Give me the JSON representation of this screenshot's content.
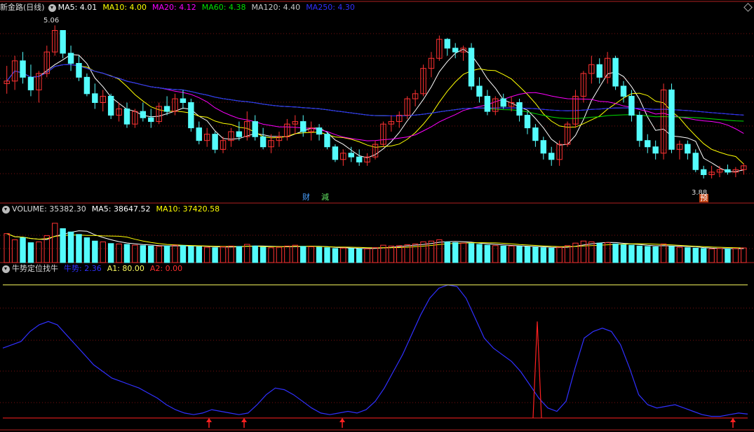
{
  "main_header": {
    "title": "新金路(日线)",
    "ma5": "MA5: 4.01",
    "ma10": "MA10: 4.00",
    "ma20": "MA20: 4.12",
    "ma60": "MA60: 4.38",
    "ma120": "MA120: 4.40",
    "ma250": "MA250: 4.30"
  },
  "volume_header": {
    "title": "VOLUME: 35382.30",
    "ma5": "MA5: 38647.52",
    "ma10": "MA10: 37420.58"
  },
  "indicator_header": {
    "title": "牛势定位找牛",
    "niushi": "牛势: 2.36",
    "a1": "A1: 80.00",
    "a2": "A2: 0.00"
  },
  "annotations": {
    "high_label": "5.06",
    "low_label": "3.88",
    "event_cai": "财",
    "event_jian": "減",
    "event_yu": "预"
  },
  "colors": {
    "up": "#ff3232",
    "down": "#54fcfc",
    "ma5": "#ffffff",
    "ma10": "#ffff00",
    "ma20": "#ff00ff",
    "ma60": "#00e000",
    "ma120": "#c8c8c8",
    "ma250": "#2020ff",
    "niushi_line": "#3030ff",
    "a1_line": "#ffff60",
    "a2_line": "#ff2020"
  },
  "chart_data": [
    {
      "type": "candlestick",
      "title": "新金路(日线)",
      "ylim": [
        3.7,
        5.15
      ],
      "high_marker": 5.06,
      "low_marker": 3.88,
      "ohlc": [
        [
          4.6,
          4.74,
          4.52,
          4.62
        ],
        [
          4.62,
          4.82,
          4.55,
          4.78
        ],
        [
          4.78,
          4.85,
          4.6,
          4.65
        ],
        [
          4.65,
          4.75,
          4.5,
          4.55
        ],
        [
          4.55,
          4.7,
          4.45,
          4.68
        ],
        [
          4.68,
          4.9,
          4.65,
          4.85
        ],
        [
          4.85,
          5.06,
          4.82,
          5.02
        ],
        [
          5.02,
          5.0,
          4.8,
          4.84
        ],
        [
          4.84,
          4.9,
          4.7,
          4.76
        ],
        [
          4.76,
          4.82,
          4.62,
          4.65
        ],
        [
          4.65,
          4.68,
          4.5,
          4.52
        ],
        [
          4.52,
          4.6,
          4.4,
          4.45
        ],
        [
          4.45,
          4.55,
          4.38,
          4.5
        ],
        [
          4.5,
          4.52,
          4.32,
          4.35
        ],
        [
          4.35,
          4.45,
          4.3,
          4.4
        ],
        [
          4.4,
          4.45,
          4.25,
          4.28
        ],
        [
          4.28,
          4.4,
          4.25,
          4.38
        ],
        [
          4.38,
          4.45,
          4.3,
          4.33
        ],
        [
          4.33,
          4.4,
          4.25,
          4.3
        ],
        [
          4.3,
          4.45,
          4.28,
          4.42
        ],
        [
          4.42,
          4.5,
          4.35,
          4.38
        ],
        [
          4.38,
          4.52,
          4.35,
          4.48
        ],
        [
          4.48,
          4.55,
          4.4,
          4.45
        ],
        [
          4.45,
          4.48,
          4.22,
          4.25
        ],
        [
          4.25,
          4.3,
          4.12,
          4.15
        ],
        [
          4.15,
          4.25,
          4.1,
          4.2
        ],
        [
          4.2,
          4.22,
          4.05,
          4.08
        ],
        [
          4.08,
          4.18,
          4.05,
          4.15
        ],
        [
          4.15,
          4.25,
          4.1,
          4.22
        ],
        [
          4.22,
          4.3,
          4.15,
          4.18
        ],
        [
          4.18,
          4.38,
          4.15,
          4.3
        ],
        [
          4.3,
          4.35,
          4.15,
          4.18
        ],
        [
          4.18,
          4.25,
          4.08,
          4.1
        ],
        [
          4.1,
          4.2,
          4.05,
          4.15
        ],
        [
          4.15,
          4.22,
          4.1,
          4.18
        ],
        [
          4.18,
          4.32,
          4.15,
          4.28
        ],
        [
          4.28,
          4.35,
          4.2,
          4.3
        ],
        [
          4.3,
          4.35,
          4.18,
          4.22
        ],
        [
          4.22,
          4.3,
          4.15,
          4.25
        ],
        [
          4.25,
          4.28,
          4.15,
          4.2
        ],
        [
          4.2,
          4.22,
          4.08,
          4.1
        ],
        [
          4.1,
          4.12,
          3.98,
          4.0
        ],
        [
          4.0,
          4.08,
          3.95,
          4.05
        ],
        [
          4.05,
          4.1,
          3.98,
          4.02
        ],
        [
          4.02,
          4.08,
          3.95,
          3.98
        ],
        [
          3.98,
          4.05,
          3.95,
          4.02
        ],
        [
          4.02,
          4.15,
          4.0,
          4.12
        ],
        [
          4.12,
          4.3,
          4.1,
          4.28
        ],
        [
          4.28,
          4.35,
          4.22,
          4.3
        ],
        [
          4.3,
          4.38,
          4.25,
          4.35
        ],
        [
          4.35,
          4.5,
          4.32,
          4.48
        ],
        [
          4.48,
          4.55,
          4.42,
          4.52
        ],
        [
          4.52,
          4.75,
          4.5,
          4.72
        ],
        [
          4.72,
          4.85,
          4.65,
          4.8
        ],
        [
          4.8,
          4.98,
          4.78,
          4.95
        ],
        [
          4.95,
          4.96,
          4.82,
          4.88
        ],
        [
          4.88,
          4.92,
          4.8,
          4.85
        ],
        [
          4.85,
          4.9,
          4.78,
          4.88
        ],
        [
          4.88,
          4.92,
          4.55,
          4.58
        ],
        [
          4.58,
          4.65,
          4.45,
          4.5
        ],
        [
          4.5,
          4.55,
          4.35,
          4.38
        ],
        [
          4.38,
          4.5,
          4.35,
          4.48
        ],
        [
          4.48,
          4.52,
          4.4,
          4.42
        ],
        [
          4.42,
          4.5,
          4.38,
          4.45
        ],
        [
          4.45,
          4.48,
          4.3,
          4.35
        ],
        [
          4.35,
          4.38,
          4.2,
          4.25
        ],
        [
          4.25,
          4.28,
          4.1,
          4.15
        ],
        [
          4.15,
          4.18,
          4.0,
          4.05
        ],
        [
          4.05,
          4.1,
          3.95,
          4.0
        ],
        [
          4.0,
          4.15,
          3.95,
          4.12
        ],
        [
          4.12,
          4.3,
          4.1,
          4.28
        ],
        [
          4.28,
          4.55,
          4.25,
          4.5
        ],
        [
          4.5,
          4.7,
          4.45,
          4.68
        ],
        [
          4.68,
          4.82,
          4.6,
          4.75
        ],
        [
          4.75,
          4.8,
          4.6,
          4.65
        ],
        [
          4.65,
          4.85,
          4.6,
          4.8
        ],
        [
          4.8,
          4.82,
          4.55,
          4.58
        ],
        [
          4.58,
          4.62,
          4.45,
          4.5
        ],
        [
          4.5,
          4.55,
          4.3,
          4.35
        ],
        [
          4.35,
          4.38,
          4.1,
          4.15
        ],
        [
          4.15,
          4.2,
          4.05,
          4.1
        ],
        [
          4.1,
          4.15,
          4.0,
          4.05
        ],
        [
          4.05,
          4.6,
          4.0,
          4.55
        ],
        [
          4.55,
          4.6,
          4.05,
          4.08
        ],
        [
          4.08,
          4.15,
          4.0,
          4.12
        ],
        [
          4.12,
          4.15,
          4.0,
          4.05
        ],
        [
          4.05,
          4.08,
          3.9,
          3.92
        ],
        [
          3.92,
          3.95,
          3.85,
          3.88
        ],
        [
          3.88,
          3.95,
          3.85,
          3.9
        ],
        [
          3.9,
          3.95,
          3.86,
          3.92
        ],
        [
          3.92,
          3.96,
          3.88,
          3.9
        ],
        [
          3.9,
          3.94,
          3.86,
          3.92
        ],
        [
          3.92,
          3.97,
          3.88,
          3.95
        ]
      ]
    },
    {
      "type": "bar",
      "title": "VOLUME: 35382.30",
      "ylim": [
        0,
        110000
      ],
      "values": [
        70000,
        55000,
        60000,
        48000,
        50000,
        65000,
        95000,
        82000,
        74000,
        68000,
        60000,
        52000,
        50000,
        46000,
        45000,
        44000,
        42000,
        41000,
        40000,
        39000,
        40000,
        42000,
        41000,
        39000,
        38000,
        37000,
        36000,
        38000,
        40000,
        39000,
        44000,
        40000,
        37000,
        36000,
        37000,
        40000,
        42000,
        39000,
        38000,
        37000,
        36000,
        34000,
        35000,
        34000,
        33000,
        33000,
        36000,
        42000,
        40000,
        41000,
        43000,
        45000,
        50000,
        52000,
        55000,
        50000,
        48000,
        47000,
        46000,
        44000,
        42000,
        41000,
        40000,
        40000,
        39000,
        38000,
        37000,
        36000,
        35000,
        37000,
        41000,
        47000,
        52000,
        50000,
        47000,
        48000,
        45000,
        43000,
        42000,
        40000,
        39000,
        38000,
        45000,
        39000,
        37000,
        36000,
        35000,
        34000,
        33000,
        34000,
        33000,
        34000,
        35382
      ]
    },
    {
      "type": "line",
      "title": "牛势定位找牛",
      "ylim": [
        0,
        85
      ],
      "series": [
        {
          "name": "牛势",
          "values": [
            42,
            44,
            46,
            52,
            56,
            58,
            56,
            50,
            44,
            38,
            32,
            28,
            24,
            22,
            20,
            18,
            15,
            12,
            8,
            5,
            3,
            2,
            3,
            5,
            4,
            3,
            2,
            3,
            8,
            14,
            18,
            17,
            14,
            10,
            6,
            3,
            2,
            3,
            4,
            3,
            5,
            10,
            18,
            28,
            38,
            50,
            62,
            72,
            78,
            80,
            79,
            72,
            60,
            48,
            42,
            38,
            34,
            28,
            20,
            12,
            6,
            4,
            10,
            30,
            48,
            52,
            54,
            52,
            44,
            30,
            14,
            8,
            6,
            7,
            8,
            6,
            4,
            2,
            1,
            1,
            2,
            3,
            2.36
          ]
        },
        {
          "name": "A1",
          "values": [
            80
          ]
        },
        {
          "name": "A2",
          "values": [
            0
          ]
        }
      ]
    }
  ]
}
